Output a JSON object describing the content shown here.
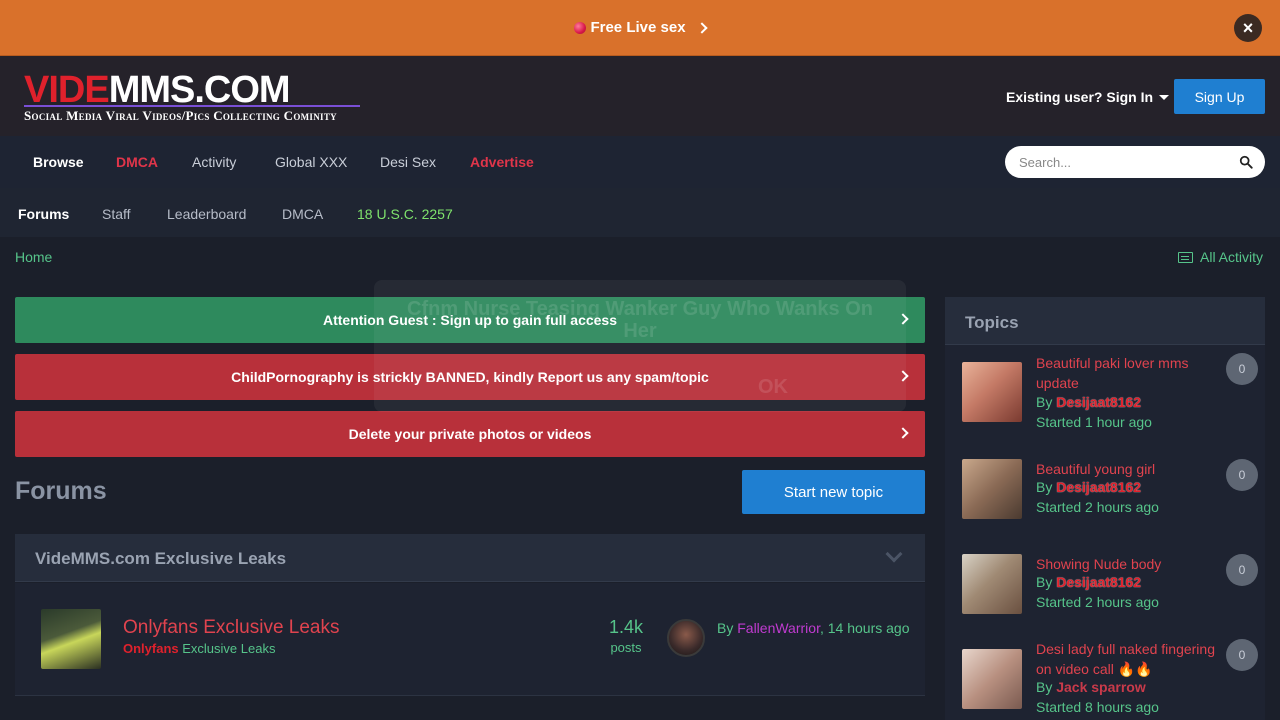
{
  "promo": {
    "label": "Free Live sex",
    "close": "×"
  },
  "header": {
    "logo_red": "VIDE",
    "logo_white": "MMS.COM",
    "logo_tagline": "Social Media Viral Videos/Pics Collecting Cominity",
    "signin_label": "Existing user? Sign In",
    "signup_label": "Sign Up"
  },
  "nav": {
    "items": [
      "Browse",
      "DMCA",
      "Activity",
      "Global XXX",
      "Desi Sex",
      "Advertise"
    ],
    "search_placeholder": "Search..."
  },
  "subnav": {
    "items": [
      "Forums",
      "Staff",
      "Leaderboard",
      "DMCA",
      "18 U.S.C. 2257"
    ]
  },
  "breadcrumb": {
    "home": "Home",
    "all_activity": "All Activity"
  },
  "banners": [
    "Attention Guest : Sign up to gain full access",
    "ChildPornography is strickly BANNED, kindly Report us any spam/topic",
    "Delete your private photos or videos"
  ],
  "ghost_popup": {
    "text": "Cfnm Nurse Teasing Wanker Guy Who Wanks On Her",
    "ok": "OK"
  },
  "main": {
    "title": "Forums",
    "start_topic": "Start new topic",
    "category": {
      "title": "VideMMS.com Exclusive Leaks",
      "forum": {
        "name": "Onlyfans Exclusive Leaks",
        "sub_red": "Onlyfans",
        "sub_green": "Exclusive Leaks",
        "count": "1.4k",
        "count_label": "posts",
        "last_by": "By ",
        "last_user": "FallenWarrior",
        "last_time": ", 14 hours ago"
      }
    }
  },
  "sidebar": {
    "title": "Topics",
    "topics": [
      {
        "title": "Beautiful paki lover mms update",
        "by": "By ",
        "user": "Desijaat8162",
        "started": "Started 1 hour ago",
        "count": "0"
      },
      {
        "title": "Beautiful young girl",
        "by": "By ",
        "user": "Desijaat8162",
        "started": "Started 2 hours ago",
        "count": "0"
      },
      {
        "title": "Showing Nude body",
        "by": "By ",
        "user": "Desijaat8162",
        "started": "Started 2 hours ago",
        "count": "0"
      },
      {
        "title": "Desi lady full naked fingering on video call 🔥🔥",
        "by": "By ",
        "user": "Jack sparrow",
        "started": "Started 8 hours ago",
        "count": "0"
      }
    ]
  },
  "colors": {
    "promo": "#d9712b",
    "accent_blue": "#1f7fd1",
    "link_green": "#56c48a",
    "alert_red": "#b8303a",
    "success_green": "#2e8a5d"
  }
}
